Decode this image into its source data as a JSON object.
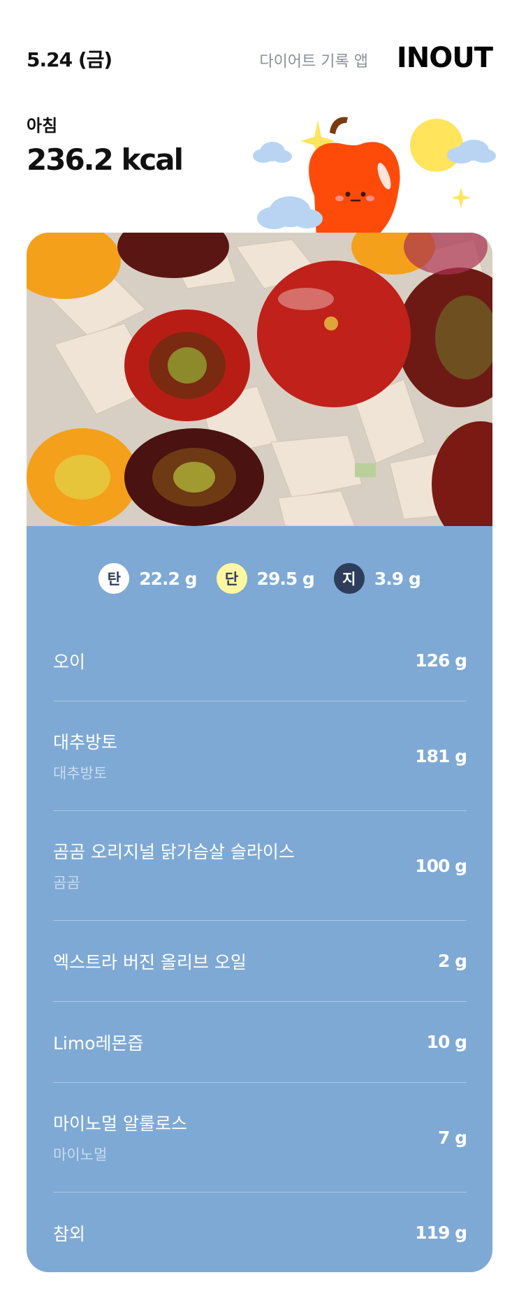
{
  "header": {
    "date": "5.24 (금)",
    "app_label": "다이어트 기록 앱",
    "logo": "INOUT"
  },
  "meal": {
    "label": "아침",
    "kcal": "236.2 kcal"
  },
  "illustration": {
    "icon": "apple-mascot-icon",
    "colors": {
      "apple": "#ff4b0a",
      "sun": "#ffe45c",
      "cloud": "#b9d4f2",
      "sparkle": "#ffe45c"
    }
  },
  "photo": {
    "icon": "meal-photo"
  },
  "colors": {
    "card_bg": "#7ea9d4",
    "carb_badge": "#ffffff",
    "protein_badge": "#fff7a0",
    "fat_badge": "#2e3d5c"
  },
  "macros": [
    {
      "badge": "탄",
      "value": "22.2 g"
    },
    {
      "badge": "단",
      "value": "29.5 g"
    },
    {
      "badge": "지",
      "value": "3.9 g"
    }
  ],
  "items": [
    {
      "name": "오이",
      "brand": "",
      "amount": "126 g"
    },
    {
      "name": "대추방토",
      "brand": "대추방토",
      "amount": "181 g"
    },
    {
      "name": "곰곰 오리지널 닭가슴살 슬라이스",
      "brand": "곰곰",
      "amount": "100 g"
    },
    {
      "name": "엑스트라 버진 올리브 오일",
      "brand": "",
      "amount": "2 g"
    },
    {
      "name": "Limo레몬즙",
      "brand": "",
      "amount": "10 g"
    },
    {
      "name": "마이노멀 알룰로스",
      "brand": "마이노멀",
      "amount": "7 g"
    },
    {
      "name": "참외",
      "brand": "",
      "amount": "119 g"
    }
  ]
}
